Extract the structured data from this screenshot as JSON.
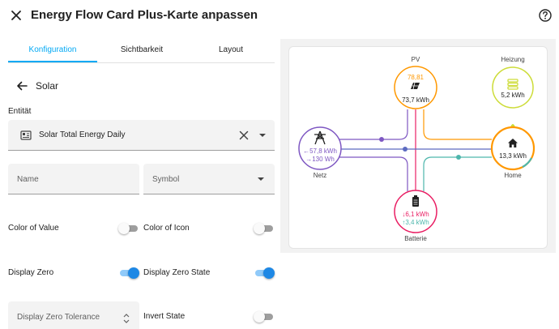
{
  "dialog": {
    "title": "Energy Flow Card Plus-Karte anpassen"
  },
  "tabs": [
    {
      "label": "Konfiguration"
    },
    {
      "label": "Sichtbarkeit"
    },
    {
      "label": "Layout"
    }
  ],
  "section": {
    "title": "Solar"
  },
  "entity": {
    "label": "Entität",
    "value": "Solar Total Energy Daily"
  },
  "fields": {
    "name_label": "Name",
    "symbol_label": "Symbol",
    "zero_tolerance_label": "Display Zero Tolerance"
  },
  "toggles": {
    "color_of_value": {
      "label": "Color of Value",
      "on": false
    },
    "color_of_icon": {
      "label": "Color of Icon",
      "on": false
    },
    "display_zero": {
      "label": "Display Zero",
      "on": true
    },
    "display_zero_state": {
      "label": "Display Zero State",
      "on": true
    },
    "invert_state": {
      "label": "Invert State",
      "on": false
    }
  },
  "preview": {
    "pv": {
      "label": "PV",
      "secondary": "78,81",
      "value": "73,7 kWh"
    },
    "heating": {
      "label": "Heizung",
      "value": "5,2 kWh"
    },
    "grid": {
      "label": "Netz",
      "consumption": "←57,8 kWh",
      "return": "→130 Wh"
    },
    "home": {
      "label": "Home",
      "value": "13,3 kWh"
    },
    "battery": {
      "label": "Batterie",
      "out": "↓6,1 kWh",
      "in": "↑3,4 kWh"
    },
    "colors": {
      "solar": "#ff9800",
      "grid": "#7e57c2",
      "battery": "#e91e63",
      "battery_in": "#4db6ac",
      "heating": "#cddc39",
      "home": "#ff9800",
      "grid_to_home": "#5c6bc0"
    }
  }
}
